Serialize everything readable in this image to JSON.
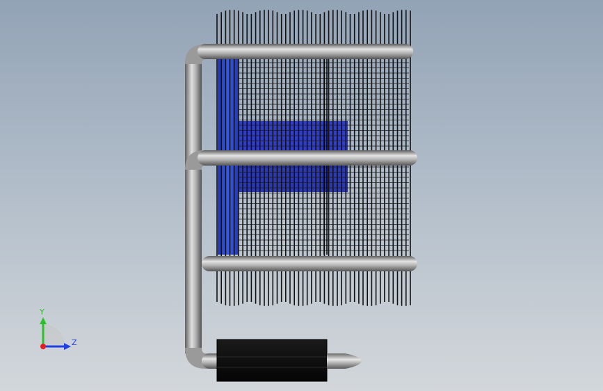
{
  "viewport": {
    "background_top": "#93a3b6",
    "background_bottom": "#d3d7db"
  },
  "model": {
    "fin_color": "#111111",
    "heat_pipe_color": "#a9a9a9",
    "highlight_color": "#1f3ed8",
    "base_block_color": "#0d0d0d"
  },
  "triad": {
    "y_label": "Y",
    "z_label": "Z",
    "y_color": "#2cc02c",
    "z_color": "#2040e0",
    "x_color": "#e02020"
  }
}
